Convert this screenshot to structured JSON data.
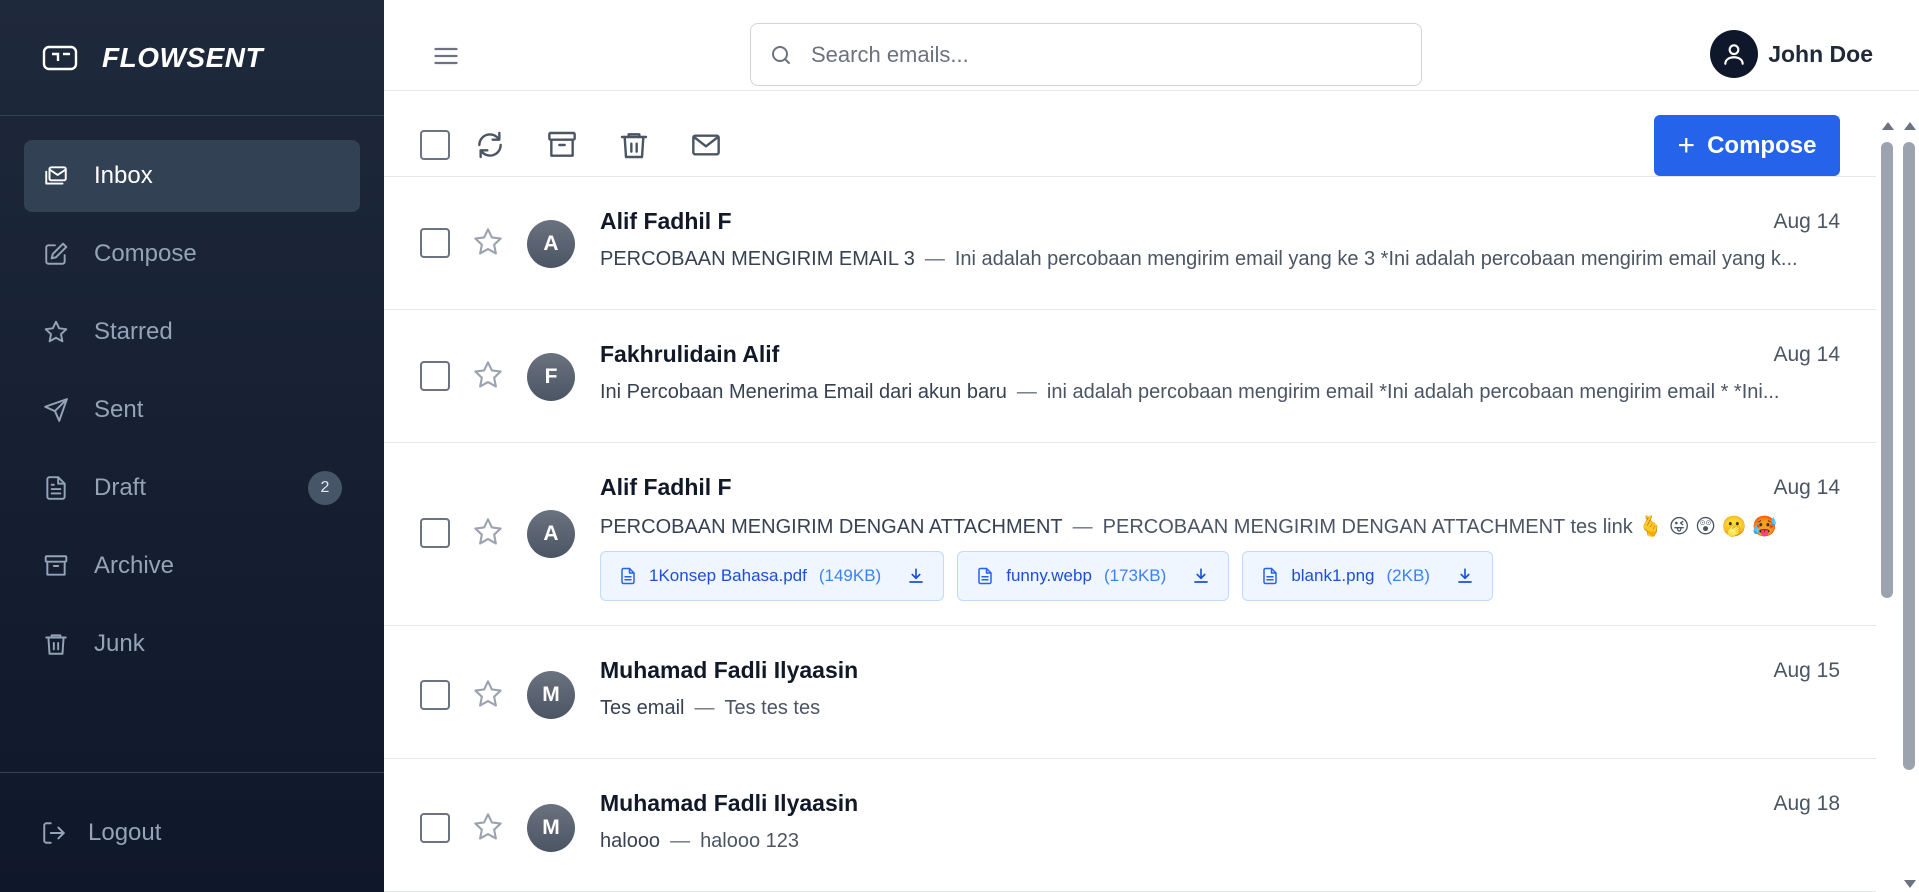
{
  "brand": {
    "name": "FLOWSENT"
  },
  "sidebar": {
    "items": [
      {
        "label": "Inbox",
        "icon": "inbox-icon",
        "active": true
      },
      {
        "label": "Compose",
        "icon": "edit-icon"
      },
      {
        "label": "Starred",
        "icon": "star-icon"
      },
      {
        "label": "Sent",
        "icon": "send-icon"
      },
      {
        "label": "Draft",
        "icon": "file-icon",
        "badge": "2"
      },
      {
        "label": "Archive",
        "icon": "archive-icon"
      },
      {
        "label": "Junk",
        "icon": "trash-icon"
      }
    ],
    "logout": "Logout"
  },
  "header": {
    "search_placeholder": "Search emails...",
    "user_name": "John Doe"
  },
  "toolbar": {
    "compose_label": "Compose"
  },
  "emails": [
    {
      "initial": "A",
      "sender": "Alif Fadhil F",
      "date": "Aug 14",
      "subject": "PERCOBAAN MENGIRIM EMAIL 3",
      "preview": "Ini adalah percobaan mengirim email yang ke 3 *Ini adalah percobaan mengirim email yang k..."
    },
    {
      "initial": "F",
      "sender": "Fakhrulidain Alif",
      "date": "Aug 14",
      "subject": "Ini Percobaan Menerima Email dari akun baru",
      "preview": "ini adalah percobaan mengirim email *Ini adalah percobaan mengirim email * *Ini..."
    },
    {
      "initial": "A",
      "sender": "Alif Fadhil F",
      "date": "Aug 14",
      "subject": "PERCOBAAN MENGIRIM DENGAN ATTACHMENT",
      "preview": "PERCOBAAN MENGIRIM DENGAN ATTACHMENT tes link 🫰 😜 😲 🫢 🥵",
      "attachments": [
        {
          "name": "1Konsep Bahasa.pdf",
          "size": "(149KB)"
        },
        {
          "name": "funny.webp",
          "size": "(173KB)"
        },
        {
          "name": "blank1.png",
          "size": "(2KB)"
        }
      ]
    },
    {
      "initial": "M",
      "sender": "Muhamad Fadli Ilyaasin",
      "date": "Aug 15",
      "subject": "Tes email",
      "preview": "Tes tes tes"
    },
    {
      "initial": "M",
      "sender": "Muhamad Fadli Ilyaasin",
      "date": "Aug 18",
      "subject": "halooo",
      "preview": "halooo 123"
    }
  ],
  "colors": {
    "accent": "#2563eb",
    "sidebar_bg": "#0f172a"
  }
}
